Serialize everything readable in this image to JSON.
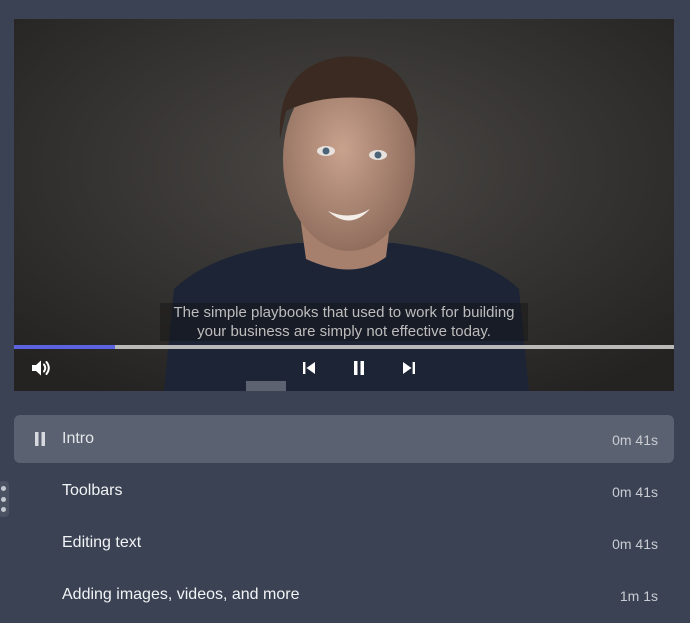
{
  "video": {
    "subtitle": "The simple playbooks that used to work for building your business are simply not effective today.",
    "progress_fraction": 0.153
  },
  "controls": {
    "volume_icon": "volume-icon",
    "prev_icon": "skip-previous-icon",
    "play_state_icon": "pause-icon",
    "next_icon": "skip-next-icon"
  },
  "playlist": {
    "items": [
      {
        "title": "Intro",
        "duration": "0m 41s",
        "active": true
      },
      {
        "title": "Toolbars",
        "duration": "0m 41s",
        "active": false
      },
      {
        "title": "Editing text",
        "duration": "0m 41s",
        "active": false
      },
      {
        "title": "Adding images, videos, and more",
        "duration": "1m 1s",
        "active": false
      }
    ]
  },
  "colors": {
    "background": "#3a4253",
    "active_item": "#5a6170",
    "progress_fill": "#5b63e0",
    "progress_track": "#b9b9b9"
  }
}
